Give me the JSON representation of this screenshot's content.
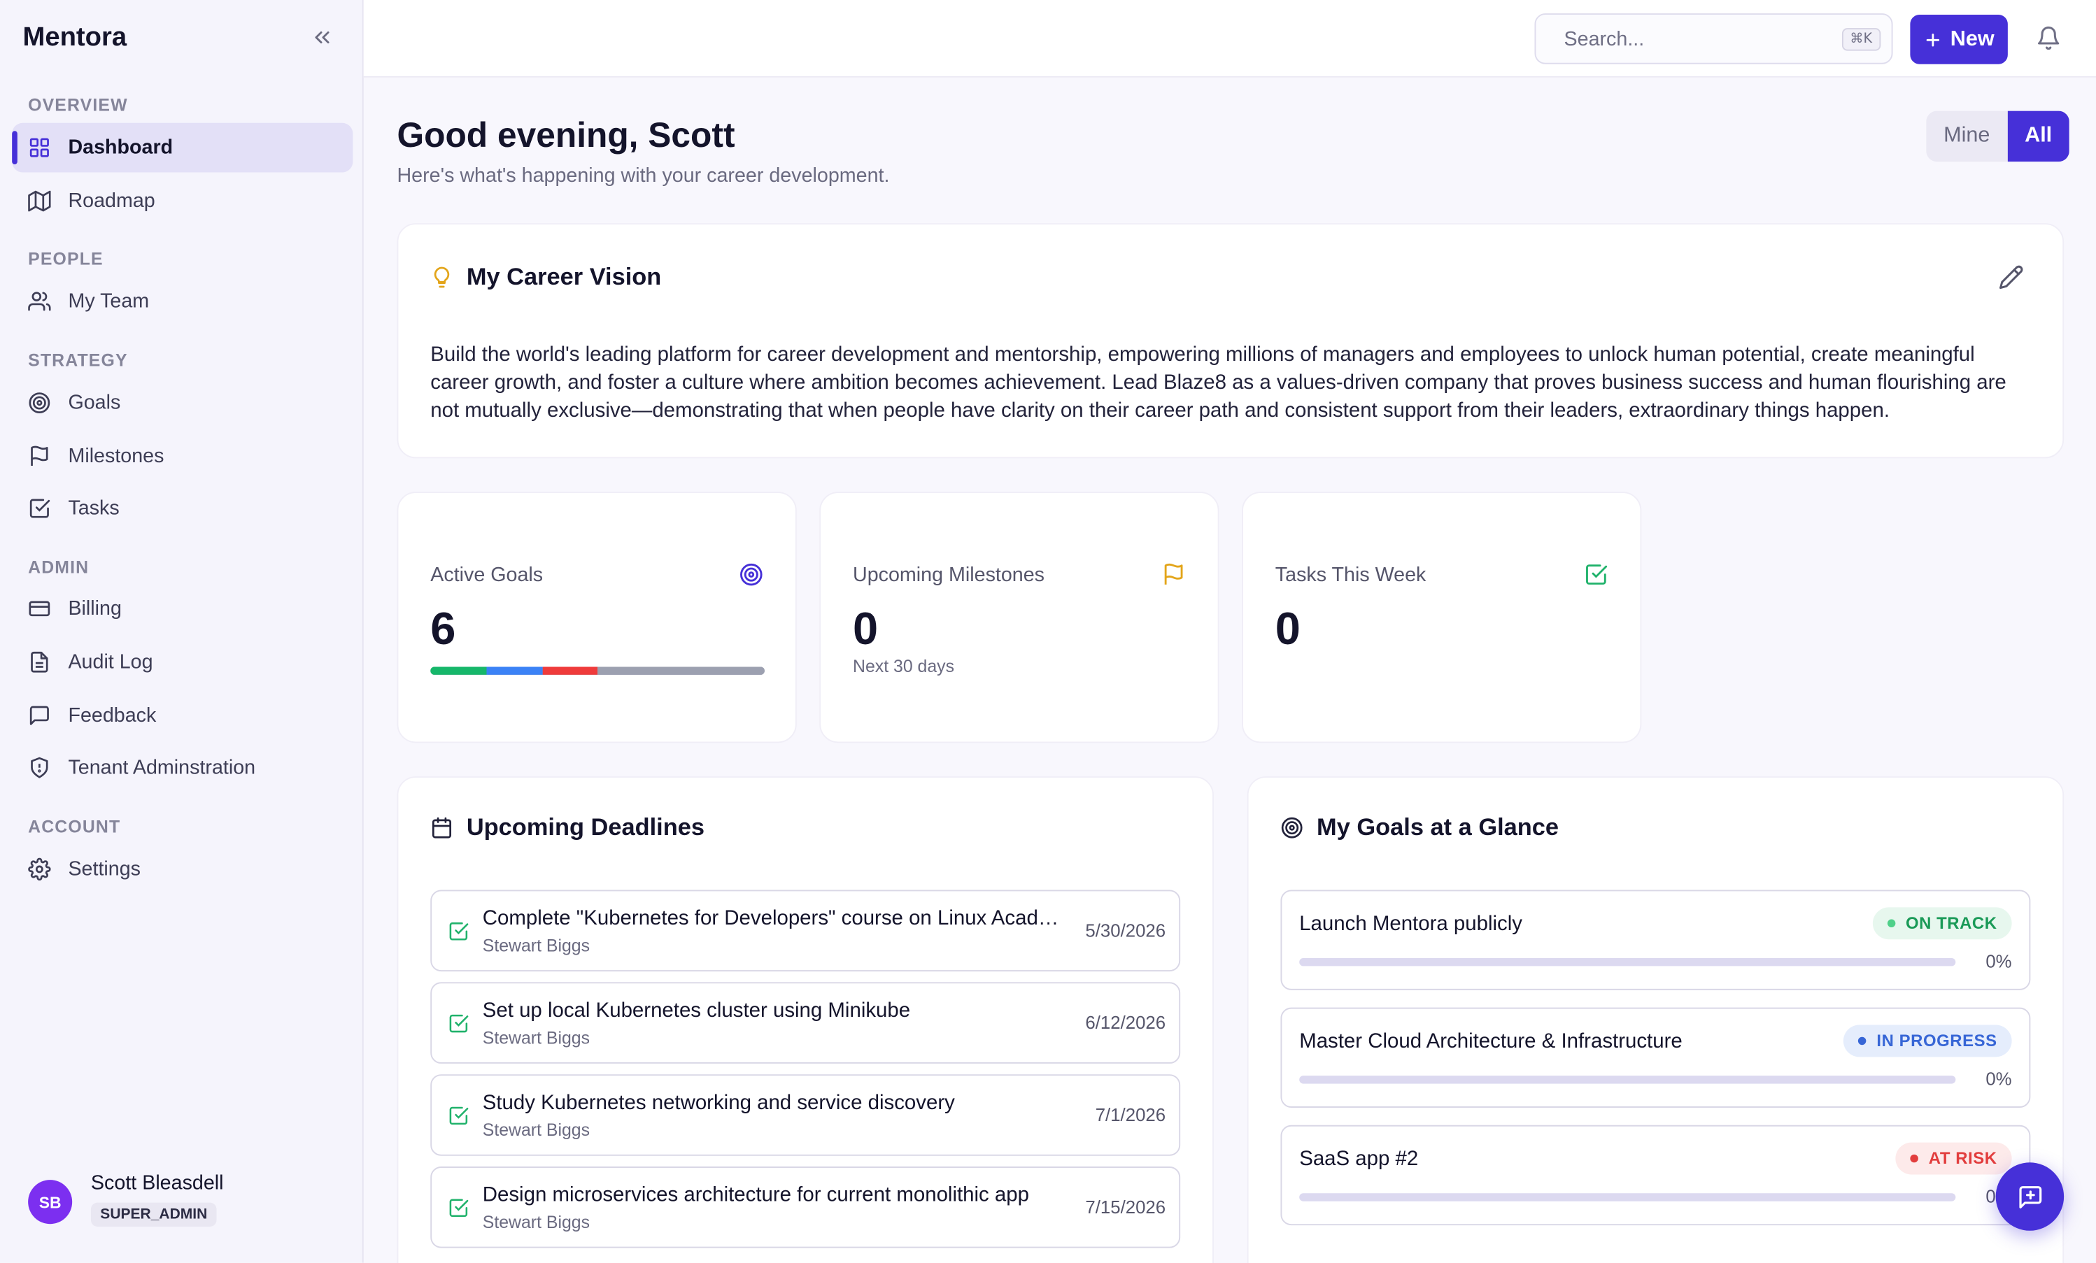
{
  "app": {
    "name": "Mentora"
  },
  "sidebar": {
    "sections": [
      {
        "label": "OVERVIEW"
      },
      {
        "label": "PEOPLE"
      },
      {
        "label": "STRATEGY"
      },
      {
        "label": "ADMIN"
      },
      {
        "label": "ACCOUNT"
      }
    ],
    "items": [
      {
        "label": "Dashboard",
        "icon": "grid-icon",
        "active": true
      },
      {
        "label": "Roadmap",
        "icon": "map-icon"
      },
      {
        "label": "My Team",
        "icon": "users-icon"
      },
      {
        "label": "Goals",
        "icon": "target-icon"
      },
      {
        "label": "Milestones",
        "icon": "flag-icon"
      },
      {
        "label": "Tasks",
        "icon": "check-square-icon"
      },
      {
        "label": "Billing",
        "icon": "credit-card-icon"
      },
      {
        "label": "Audit Log",
        "icon": "file-text-icon"
      },
      {
        "label": "Feedback",
        "icon": "message-square-icon"
      },
      {
        "label": "Tenant Adminstration",
        "icon": "shield-icon"
      },
      {
        "label": "Settings",
        "icon": "gear-icon"
      }
    ],
    "user": {
      "initials": "SB",
      "name": "Scott Bleasdell",
      "role": "SUPER_ADMIN"
    }
  },
  "topbar": {
    "search": {
      "placeholder": "Search...",
      "value": "",
      "shortcut": "⌘K"
    },
    "new_label": "New"
  },
  "header": {
    "greeting": "Good evening, Scott",
    "subtitle": "Here's what's happening with your career development.",
    "toggle": {
      "mine": "Mine",
      "all": "All",
      "selected": "All"
    }
  },
  "vision": {
    "title": "My Career Vision",
    "text": "Build the world's leading platform for career development and mentorship, empowering millions of managers and employees to unlock human potential, create meaningful career growth, and foster a culture where ambition becomes achievement. Lead Blaze8 as a values-driven company that proves business success and human flourishing are not mutually exclusive—demonstrating that when people have clarity on their career path and consistent support from their leaders, extraordinary things happen."
  },
  "stats": {
    "active_goals": {
      "label": "Active Goals",
      "value": "6",
      "breakdown": [
        {
          "status": "on-track",
          "fraction": 0.167,
          "color": "#16b76a"
        },
        {
          "status": "in-progress",
          "fraction": 0.167,
          "color": "#3b82f6"
        },
        {
          "status": "at-risk",
          "fraction": 0.166,
          "color": "#ef3b3b"
        },
        {
          "status": "other",
          "fraction": 0.5,
          "color": "#9ca0b0"
        }
      ]
    },
    "milestones": {
      "label": "Upcoming Milestones",
      "value": "0",
      "sub": "Next 30 days"
    },
    "tasks": {
      "label": "Tasks This Week",
      "value": "0"
    }
  },
  "deadlines": {
    "title": "Upcoming Deadlines",
    "items": [
      {
        "title": "Complete \"Kubernetes for Developers\" course on Linux Academy",
        "owner": "Stewart Biggs",
        "date": "5/30/2026"
      },
      {
        "title": "Set up local Kubernetes cluster using Minikube",
        "owner": "Stewart Biggs",
        "date": "6/12/2026"
      },
      {
        "title": "Study Kubernetes networking and service discovery",
        "owner": "Stewart Biggs",
        "date": "7/1/2026"
      },
      {
        "title": "Design microservices architecture for current monolithic app",
        "owner": "Stewart Biggs",
        "date": "7/15/2026"
      }
    ]
  },
  "goals": {
    "title": "My Goals at a Glance",
    "items": [
      {
        "title": "Launch Mentora publicly",
        "status": "ON TRACK",
        "progress": "0%",
        "progress_value": 0,
        "badge_bg": "#e7f7ee",
        "badge_fg": "#1a9a57",
        "dot": "#4fd089"
      },
      {
        "title": "Master Cloud Architecture & Infrastructure",
        "status": "IN PROGRESS",
        "progress": "0%",
        "progress_value": 0,
        "badge_bg": "#e5edfc",
        "badge_fg": "#3766d6",
        "dot": "#3766d6"
      },
      {
        "title": "SaaS app #2",
        "status": "AT RISK",
        "progress": "0%",
        "progress_value": 0,
        "badge_bg": "#fdeaea",
        "badge_fg": "#e23d3d",
        "dot": "#e23d3d"
      }
    ]
  },
  "colors": {
    "accent": "#4630d8"
  }
}
